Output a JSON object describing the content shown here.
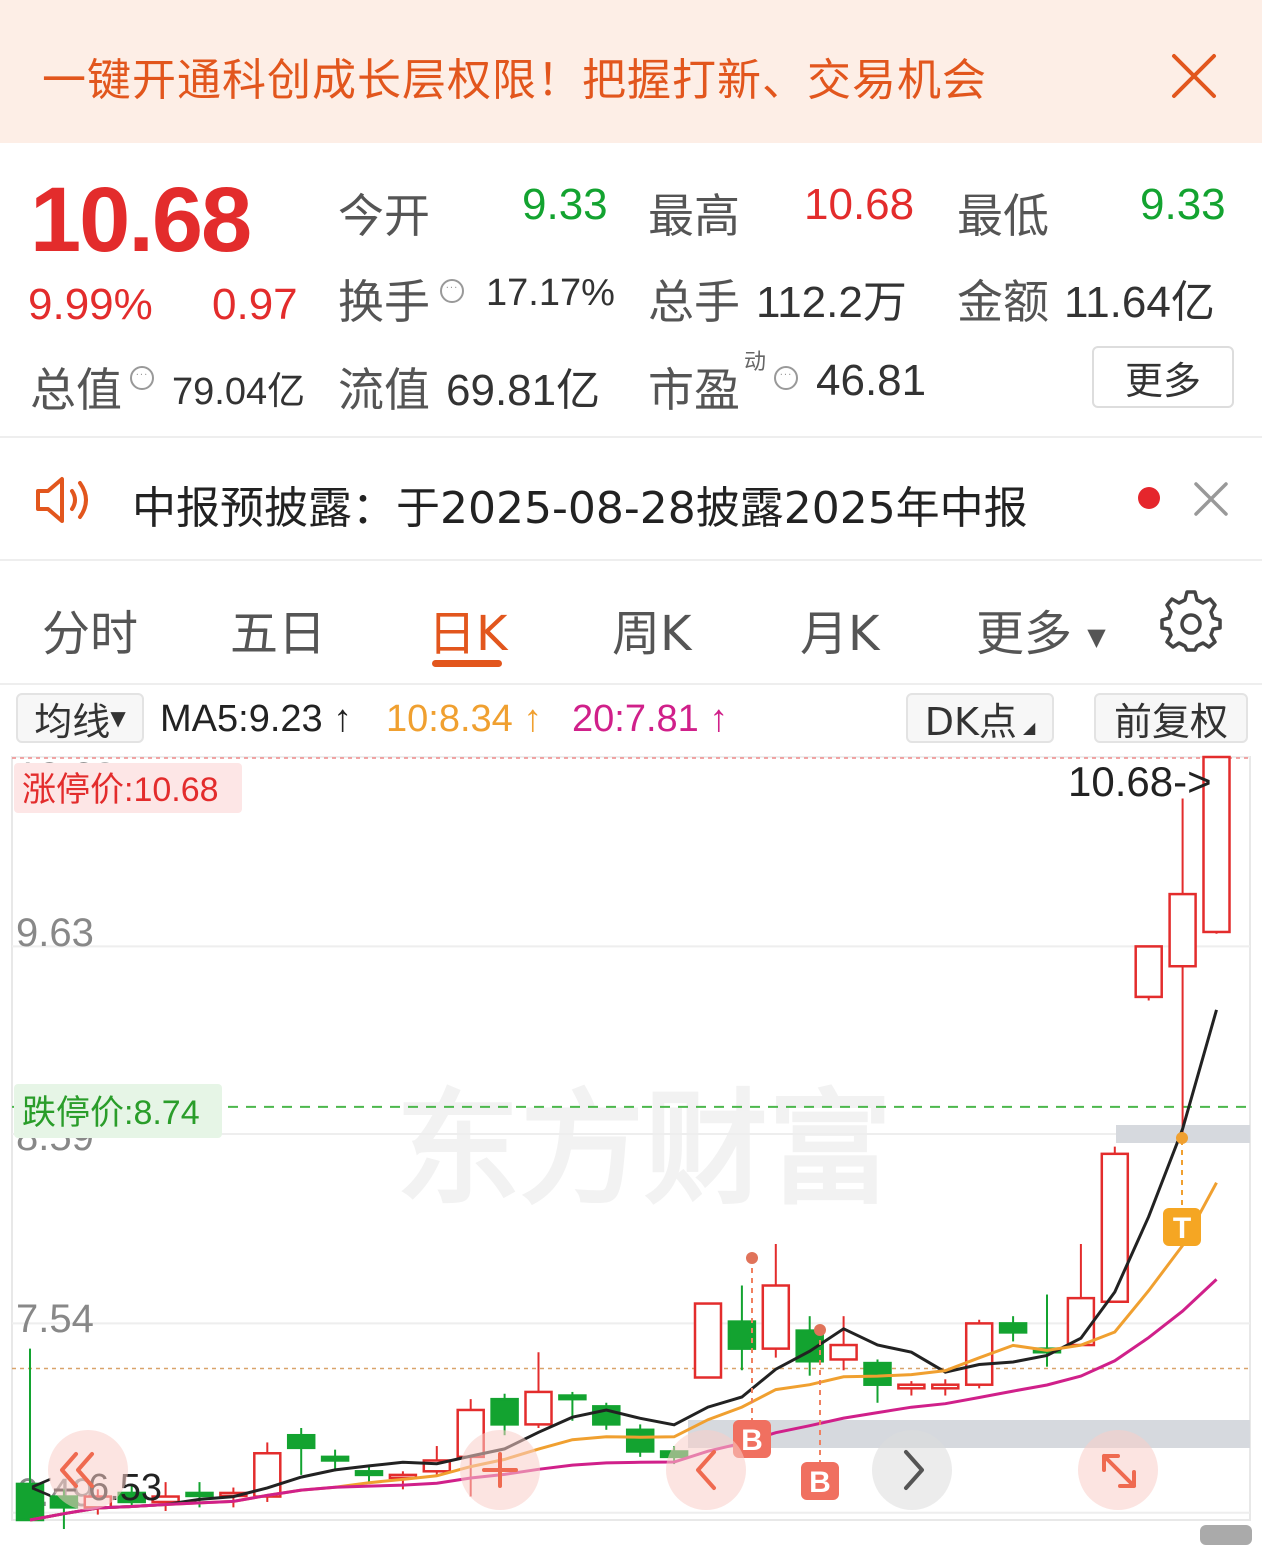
{
  "banner": {
    "text": "一键开通科创成长层权限！把握打新、交易机会",
    "close_icon": "close-icon"
  },
  "quote": {
    "price": "10.68",
    "change_pct": "9.99%",
    "change": "0.97",
    "open_label": "今开",
    "open": "9.33",
    "high_label": "最高",
    "high": "10.68",
    "low_label": "最低",
    "low": "9.33",
    "turnover_label": "换手",
    "turnover": "17.17%",
    "volume_label": "总手",
    "volume": "112.2万",
    "amount_label": "金额",
    "amount": "11.64亿",
    "mktcap_label": "总值",
    "mktcap": "79.04亿",
    "float_label": "流值",
    "float_cap": "69.81亿",
    "pe_label": "市盈",
    "pe_sup": "动",
    "pe": "46.81",
    "more_label": "更多"
  },
  "notice": {
    "text": "中报预披露：于2025-08-28披露2025年中报",
    "speaker_icon": "speaker-icon",
    "close_icon": "close-icon"
  },
  "tabs": [
    "分时",
    "五日",
    "日K",
    "周K",
    "月K",
    "更多"
  ],
  "active_tab": "日K",
  "toolbar": {
    "indicator_label": "均线",
    "ma5": "MA5:9.23",
    "ma10": "10:8.34",
    "ma20": "20:7.81",
    "dk_label": "DK点",
    "adjust_label": "前复权"
  },
  "colors": {
    "up": "#e32c2c",
    "down": "#13a330",
    "accent": "#e2561d",
    "ma5": "#222222",
    "ma10": "#f0a030",
    "ma20": "#d0208a"
  },
  "chart_data": {
    "type": "candlestick",
    "y_ticks": [
      "10.68",
      "9.63",
      "8.59",
      "7.54",
      "6.49"
    ],
    "limit_up_label": "涨停价:10.68",
    "limit_down_label": "跌停价:8.74",
    "last_price_label": "10.68->",
    "low_mark_label": "<-- 6.53",
    "signal_b": "B",
    "signal_t": "T",
    "candles": [
      {
        "o": 6.65,
        "c": 6.45,
        "h": 7.4,
        "l": 6.45
      },
      {
        "o": 6.58,
        "c": 6.52,
        "h": 6.62,
        "l": 6.4
      },
      {
        "o": 6.52,
        "c": 6.58,
        "h": 6.62,
        "l": 6.48
      },
      {
        "o": 6.6,
        "c": 6.55,
        "h": 6.65,
        "l": 6.52
      },
      {
        "o": 6.55,
        "c": 6.58,
        "h": 6.66,
        "l": 6.5
      },
      {
        "o": 6.6,
        "c": 6.59,
        "h": 6.66,
        "l": 6.52
      },
      {
        "o": 6.59,
        "c": 6.6,
        "h": 6.63,
        "l": 6.52
      },
      {
        "o": 6.58,
        "c": 6.82,
        "h": 6.88,
        "l": 6.55
      },
      {
        "o": 6.92,
        "c": 6.85,
        "h": 6.96,
        "l": 6.7
      },
      {
        "o": 6.8,
        "c": 6.78,
        "h": 6.84,
        "l": 6.72
      },
      {
        "o": 6.72,
        "c": 6.7,
        "h": 6.75,
        "l": 6.65
      },
      {
        "o": 6.69,
        "c": 6.7,
        "h": 6.72,
        "l": 6.62
      },
      {
        "o": 6.72,
        "c": 6.78,
        "h": 6.86,
        "l": 6.69
      },
      {
        "o": 6.8,
        "c": 7.06,
        "h": 7.12,
        "l": 6.58
      },
      {
        "o": 7.12,
        "c": 6.98,
        "h": 7.15,
        "l": 6.92
      },
      {
        "o": 6.98,
        "c": 7.16,
        "h": 7.38,
        "l": 6.96
      },
      {
        "o": 7.14,
        "c": 7.12,
        "h": 7.16,
        "l": 7.0
      },
      {
        "o": 7.08,
        "c": 6.98,
        "h": 7.1,
        "l": 6.95
      },
      {
        "o": 6.95,
        "c": 6.83,
        "h": 6.98,
        "l": 6.8
      },
      {
        "o": 6.83,
        "c": 6.8,
        "h": 6.86,
        "l": 6.76
      },
      {
        "o": 7.24,
        "c": 7.65,
        "h": 7.65,
        "l": 7.24
      },
      {
        "o": 7.55,
        "c": 7.4,
        "h": 7.75,
        "l": 7.28
      },
      {
        "o": 7.4,
        "c": 7.75,
        "h": 7.98,
        "l": 7.35
      },
      {
        "o": 7.5,
        "c": 7.33,
        "h": 7.58,
        "l": 7.25
      },
      {
        "o": 7.34,
        "c": 7.42,
        "h": 7.58,
        "l": 7.28
      },
      {
        "o": 7.32,
        "c": 7.2,
        "h": 7.34,
        "l": 7.1
      },
      {
        "o": 7.18,
        "c": 7.2,
        "h": 7.22,
        "l": 7.14
      },
      {
        "o": 7.18,
        "c": 7.2,
        "h": 7.23,
        "l": 7.14
      },
      {
        "o": 7.2,
        "c": 7.54,
        "h": 7.56,
        "l": 7.18
      },
      {
        "o": 7.54,
        "c": 7.49,
        "h": 7.58,
        "l": 7.44
      },
      {
        "o": 7.4,
        "c": 7.38,
        "h": 7.7,
        "l": 7.3
      },
      {
        "o": 7.42,
        "c": 7.68,
        "h": 7.98,
        "l": 7.42
      },
      {
        "o": 7.66,
        "c": 8.48,
        "h": 8.52,
        "l": 7.66
      },
      {
        "o": 9.35,
        "c": 9.63,
        "h": 9.63,
        "l": 9.33
      },
      {
        "o": 9.52,
        "c": 9.92,
        "h": 10.45,
        "l": 8.55
      },
      {
        "o": 9.71,
        "c": 10.68,
        "h": 10.68,
        "l": 9.7
      }
    ]
  }
}
